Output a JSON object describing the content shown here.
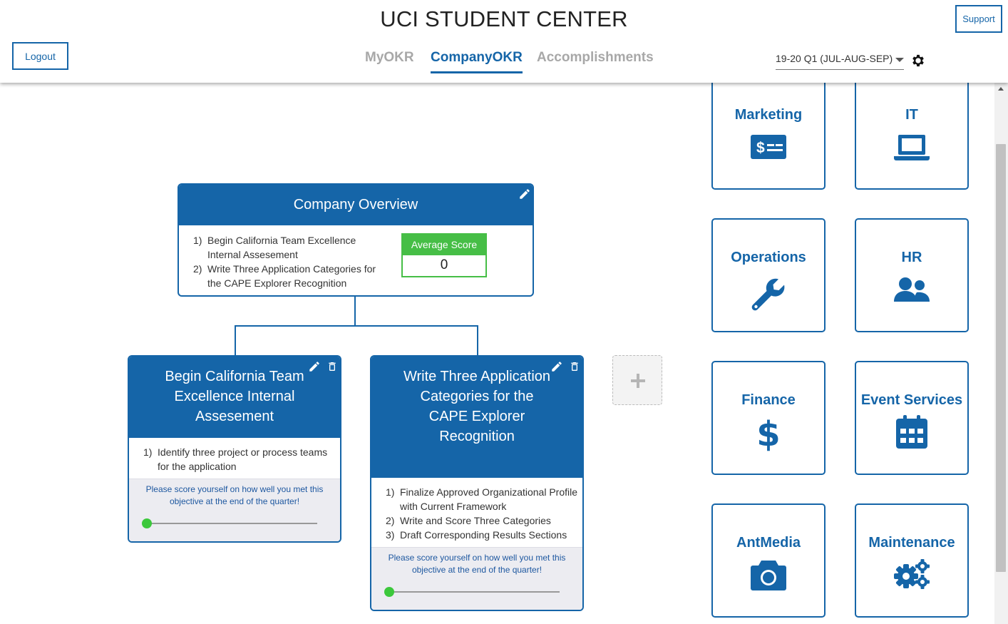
{
  "header": {
    "title": "UCI STUDENT CENTER",
    "logout_label": "Logout",
    "support_label": "Support",
    "tabs": [
      {
        "label": "MyOKR"
      },
      {
        "label": "CompanyOKR",
        "active": true
      },
      {
        "label": "Accomplishments"
      }
    ],
    "quarter_select": {
      "value": "19-20 Q1 (JUL-AUG-SEP)"
    },
    "settings_icon": "gear-icon"
  },
  "company_overview": {
    "title": "Company Overview",
    "objectives": [
      {
        "num": "1)",
        "text": "Begin California Team Excellence Internal Assesement"
      },
      {
        "num": "2)",
        "text": "Write Three Application Categories for the CAPE Explorer Recognition"
      }
    ],
    "average_score_label": "Average Score",
    "average_score_value": "0",
    "edit_icon": "pencil-icon"
  },
  "objectives": [
    {
      "title": "Begin California Team Excellence Internal Assesement",
      "key_results": [
        {
          "num": "1)",
          "text": "Identify three project or process teams for the application"
        }
      ],
      "score_prompt": "Please score yourself on how well you met this objective at the end of the quarter!",
      "score": 0
    },
    {
      "title": "Write Three Application Categories for the CAPE Explorer Recognition",
      "key_results": [
        {
          "num": "1)",
          "text": "Finalize Approved Organizational Profile with Current Framework"
        },
        {
          "num": "2)",
          "text": "Write and Score Three Categories"
        },
        {
          "num": "3)",
          "text": "Draft Corresponding Results Sections"
        }
      ],
      "score_prompt": "Please score yourself on how well you met this objective at the end of the quarter!",
      "score": 0
    }
  ],
  "add_objective_icon": "plus-icon",
  "departments": [
    {
      "name": "Marketing",
      "icon": "money-card-icon"
    },
    {
      "name": "IT",
      "icon": "laptop-icon"
    },
    {
      "name": "Operations",
      "icon": "wrench-icon"
    },
    {
      "name": "HR",
      "icon": "users-icon"
    },
    {
      "name": "Finance",
      "icon": "dollar-icon"
    },
    {
      "name": "Event Services",
      "icon": "calendar-icon"
    },
    {
      "name": "AntMedia",
      "icon": "camera-icon"
    },
    {
      "name": "Maintenance",
      "icon": "gears-icon"
    }
  ],
  "colors": {
    "primary": "#1565a8",
    "score_green": "#46be46",
    "tab_inactive": "#a8a8a8",
    "score_panel": "#ececf1"
  }
}
